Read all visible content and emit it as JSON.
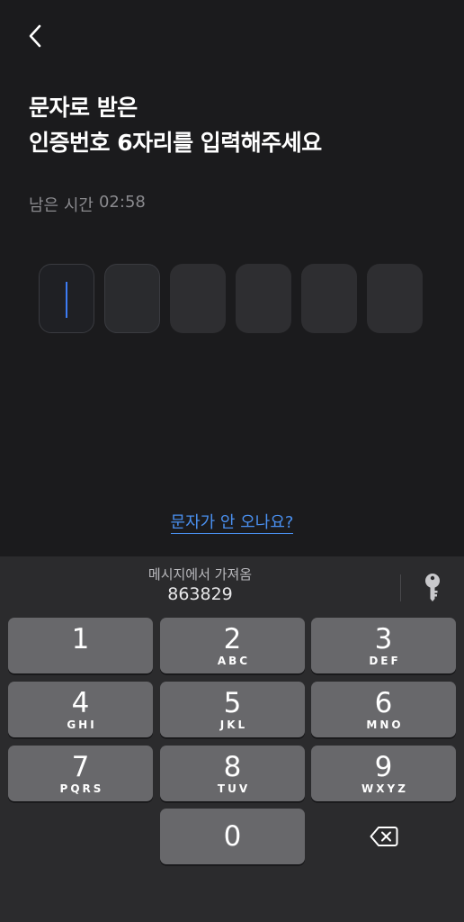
{
  "header": {
    "back_icon": "chevron-left-icon"
  },
  "title": {
    "line1": "문자로 받은",
    "line2": "인증번호 6자리를 입력해주세요"
  },
  "timer": {
    "label": "남은 시간",
    "value": "02:58"
  },
  "otp": {
    "length": 6,
    "digits": [
      "",
      "",
      "",
      "",
      "",
      ""
    ],
    "caret_color": "#3d7cf4"
  },
  "help_link": {
    "label": "문자가 안 오나요?",
    "color": "#4a90f0"
  },
  "keyboard": {
    "suggestion": {
      "label": "메시지에서 가져옴",
      "code": "863829"
    },
    "keychain_icon": "key-icon",
    "keys": [
      {
        "num": "1",
        "letters": ""
      },
      {
        "num": "2",
        "letters": "ABC"
      },
      {
        "num": "3",
        "letters": "DEF"
      },
      {
        "num": "4",
        "letters": "GHI"
      },
      {
        "num": "5",
        "letters": "JKL"
      },
      {
        "num": "6",
        "letters": "MNO"
      },
      {
        "num": "7",
        "letters": "PQRS"
      },
      {
        "num": "8",
        "letters": "TUV"
      },
      {
        "num": "9",
        "letters": "WXYZ"
      },
      {
        "num": "0",
        "letters": ""
      }
    ],
    "delete_icon": "backspace-icon"
  }
}
